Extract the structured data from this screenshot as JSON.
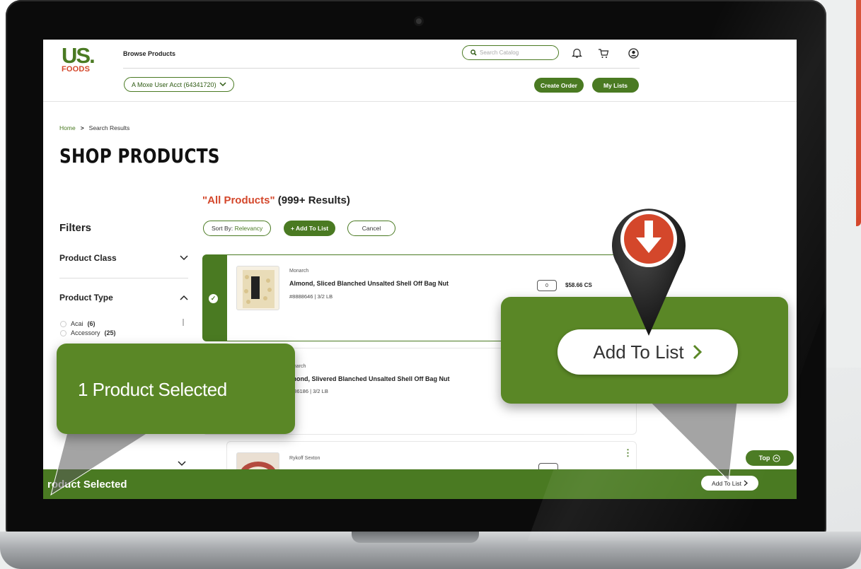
{
  "header": {
    "logo_us": "US.",
    "logo_foods": "FOODS",
    "browse_label": "Browse Products",
    "account_label": "A Moxe User Acct (64341720)",
    "search_placeholder": "Search Catalog",
    "create_order_label": "Create Order",
    "my_lists_label": "My Lists",
    "icons": [
      "search-icon",
      "bell-icon",
      "cart-icon",
      "user-icon"
    ]
  },
  "breadcrumb": {
    "home": "Home",
    "separator": ">",
    "current": "Search Results"
  },
  "page_title": "SHOP PRODUCTS",
  "results": {
    "query": "\"All Products\"",
    "count": "(999+ Results)"
  },
  "toolbar": {
    "sort_prefix": "Sort By:",
    "sort_value": "Relevancy",
    "add_to_list_label": "+ Add To List",
    "cancel_label": "Cancel"
  },
  "filters": {
    "title": "Filters",
    "facets": [
      {
        "label": "Product Class",
        "expanded": false
      },
      {
        "label": "Product Type",
        "expanded": true
      }
    ],
    "options": [
      {
        "label": "Acai",
        "count": "(6)"
      },
      {
        "label": "Accessory",
        "count": "(25)"
      }
    ]
  },
  "products": [
    {
      "brand": "Monarch",
      "name": "Almond, Sliced Blanched Unsalted Shell Off Bag Nut",
      "meta": "#8888646  |  3/2 LB",
      "qty": "0",
      "price": "$58.66 CS",
      "selected": true
    },
    {
      "brand": "onarch",
      "name": "mond, Slivered Blanched Unsalted Shell Off Bag Nut",
      "meta": "886186  |  3/2 LB",
      "selected": false
    },
    {
      "brand": "Rykoff Sexton",
      "selected": false
    }
  ],
  "top_button": "Top",
  "bottom_bar": {
    "selected_label": "roduct Selected",
    "add_label": "Add To List"
  },
  "callouts": {
    "left_text": "1 Product Selected",
    "right_button": "Add To List"
  },
  "colors": {
    "brand_green": "#4a7a22",
    "callout_green": "#5a8726",
    "accent_red": "#d4472b",
    "pin_dark": "#2b2b2b"
  }
}
